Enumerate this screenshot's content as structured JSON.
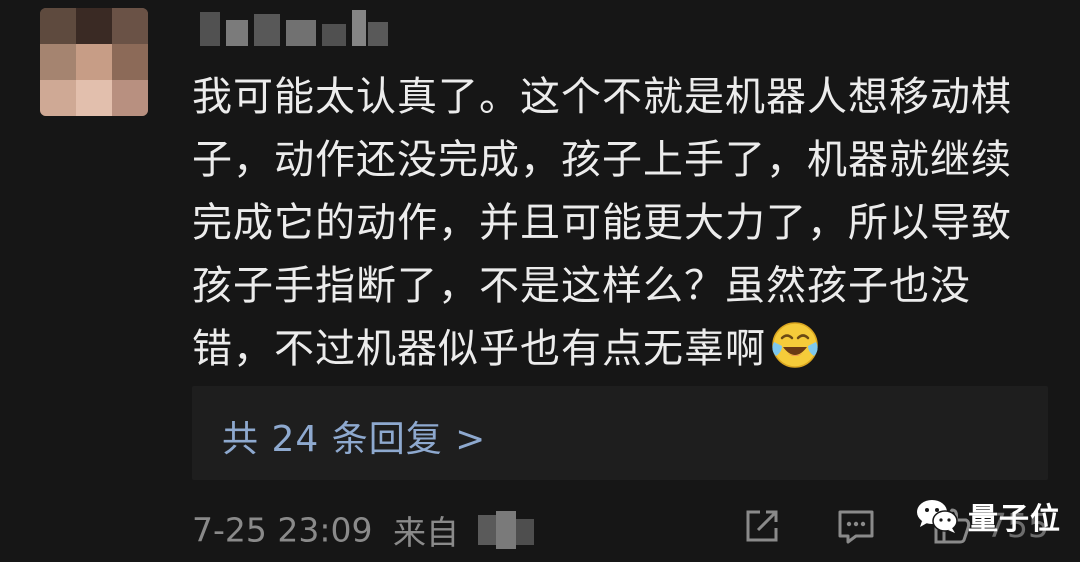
{
  "comment": {
    "lines": [
      "我可能太认真了。这个不就是机器人想移动棋",
      "子，动作还没完成，孩子上手了，机器就继续",
      "完成它的动作，并且可能更大力了，所以导致",
      "孩子手指断了，不是这样么？虽然孩子也没",
      "错，不过机器似乎也有点无辜啊"
    ],
    "emoji": "crying-laughing-emoji"
  },
  "replies": {
    "label": "共 24 条回复 >"
  },
  "meta": {
    "timestamp": "7-25 23:09",
    "source_prefix": "来自"
  },
  "actions": {
    "share_icon": "share-icon",
    "comment_icon": "comment-icon",
    "like_icon": "like-icon",
    "like_count": "755"
  },
  "watermark": {
    "text": "量子位",
    "icon": "wechat-icon"
  },
  "colors": {
    "background": "#161616",
    "reply_box": "#1e1e1e",
    "link": "#8ea9cf",
    "meta_text": "#8a8a8a",
    "comment_text": "#ececec"
  }
}
